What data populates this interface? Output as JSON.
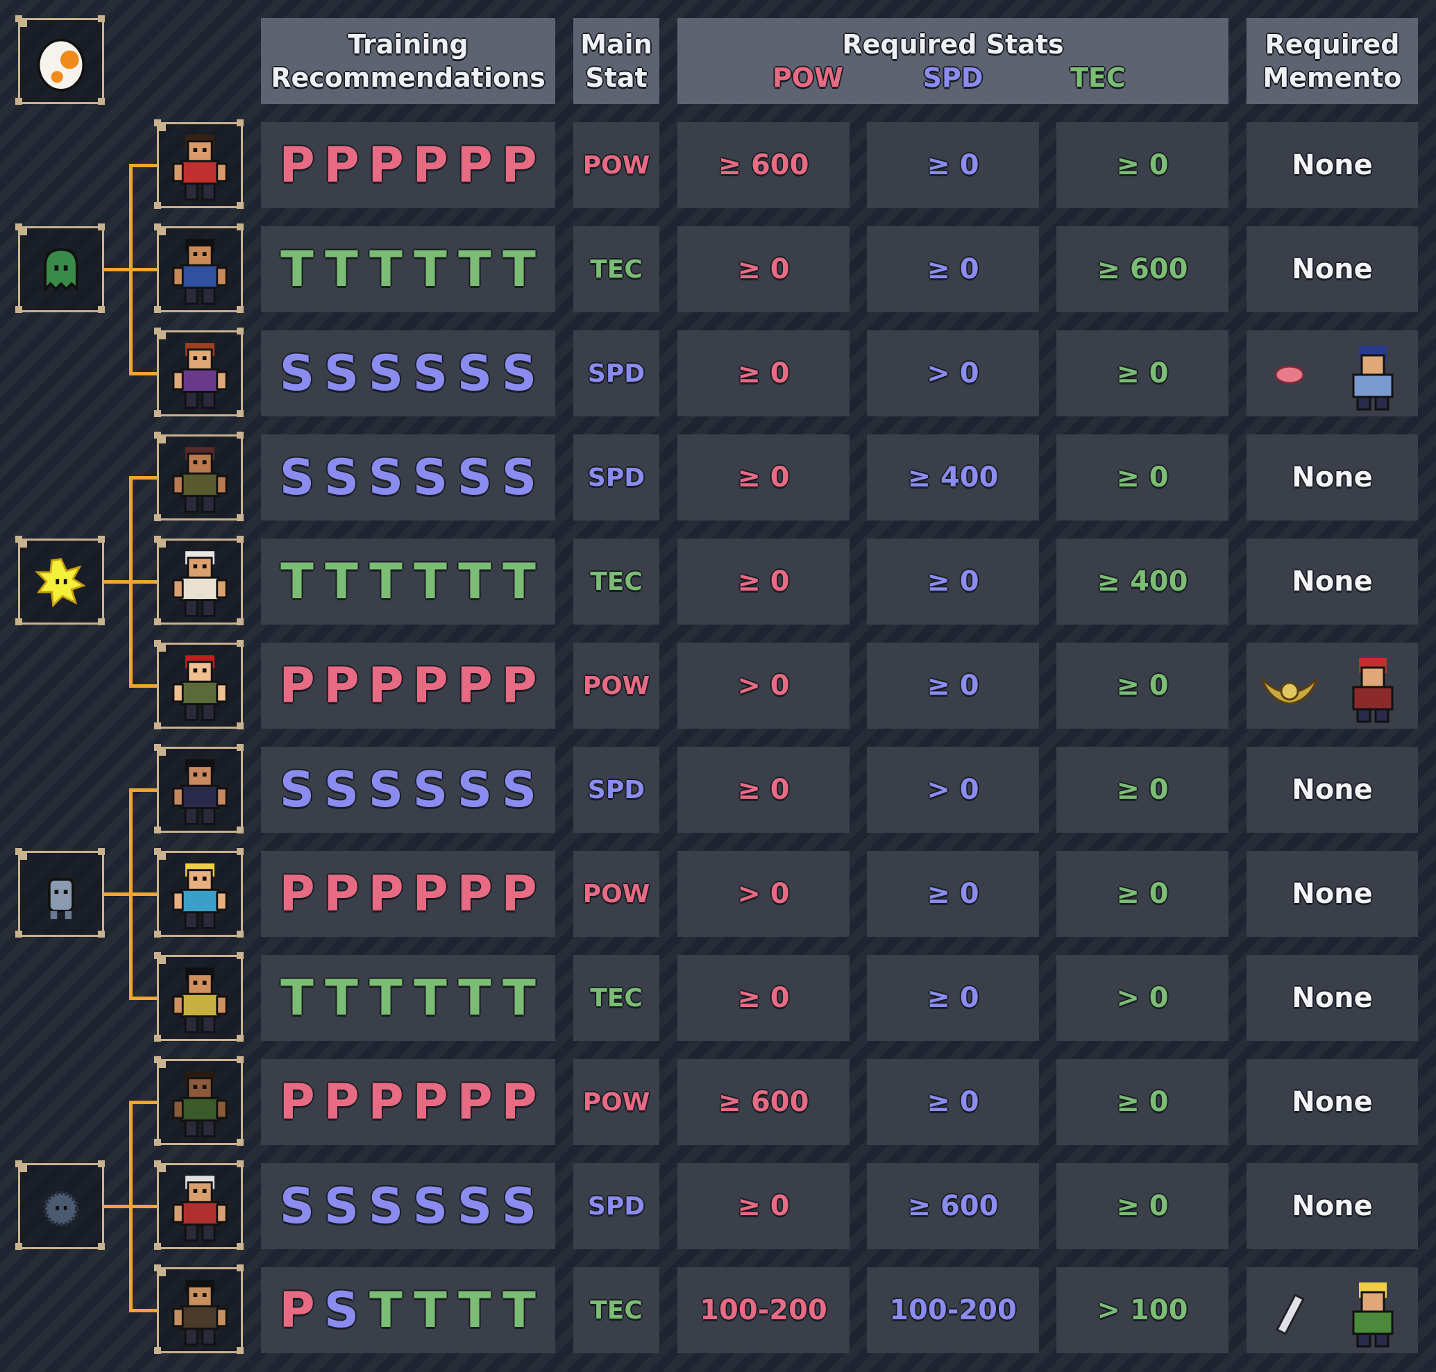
{
  "header": {
    "training": [
      "Training",
      "Recommendations"
    ],
    "main_stat": [
      "Main",
      "Stat"
    ],
    "required_stats": "Required Stats",
    "pow": "POW",
    "spd": "SPD",
    "tec": "TEC",
    "required_memento": [
      "Required",
      "Memento"
    ]
  },
  "groups": [
    {
      "base_icon": "egg-icon"
    },
    {
      "base_icon": "green-ghost-icon"
    },
    {
      "base_icon": "yellow-spark-icon"
    },
    {
      "base_icon": "grey-blob-icon"
    },
    {
      "base_icon": "dark-fuzzball-icon"
    }
  ],
  "rows": [
    {
      "fighter_icon": "fighter-1-icon",
      "training": [
        "P",
        "P",
        "P",
        "P",
        "P",
        "P"
      ],
      "main": "POW",
      "pow": "≥ 600",
      "spd": "≥ 0",
      "tec": "≥ 0",
      "memento": "None"
    },
    {
      "fighter_icon": "fighter-2-icon",
      "training": [
        "T",
        "T",
        "T",
        "T",
        "T",
        "T"
      ],
      "main": "TEC",
      "pow": "≥ 0",
      "spd": "≥ 0",
      "tec": "≥ 600",
      "memento": "None"
    },
    {
      "fighter_icon": "fighter-3-icon",
      "training": [
        "S",
        "S",
        "S",
        "S",
        "S",
        "S"
      ],
      "main": "SPD",
      "pow": "≥ 0",
      "spd": "> 0",
      "tec": "≥ 0",
      "memento": "",
      "memento_icons": [
        "brain-icon",
        "police-officer-icon"
      ]
    },
    {
      "fighter_icon": "fighter-4-icon",
      "training": [
        "S",
        "S",
        "S",
        "S",
        "S",
        "S"
      ],
      "main": "SPD",
      "pow": "≥ 0",
      "spd": "≥ 400",
      "tec": "≥ 0",
      "memento": "None"
    },
    {
      "fighter_icon": "fighter-5-icon",
      "training": [
        "T",
        "T",
        "T",
        "T",
        "T",
        "T"
      ],
      "main": "TEC",
      "pow": "≥ 0",
      "spd": "≥ 0",
      "tec": "≥ 400",
      "memento": "None"
    },
    {
      "fighter_icon": "fighter-6-icon",
      "training": [
        "P",
        "P",
        "P",
        "P",
        "P",
        "P"
      ],
      "main": "POW",
      "pow": "> 0",
      "spd": "≥ 0",
      "tec": "≥ 0",
      "memento": "",
      "memento_icons": [
        "winged-skull-icon",
        "caped-dictator-icon"
      ]
    },
    {
      "fighter_icon": "fighter-7-icon",
      "training": [
        "S",
        "S",
        "S",
        "S",
        "S",
        "S"
      ],
      "main": "SPD",
      "pow": "≥ 0",
      "spd": "> 0",
      "tec": "≥ 0",
      "memento": "None"
    },
    {
      "fighter_icon": "fighter-8-icon",
      "training": [
        "P",
        "P",
        "P",
        "P",
        "P",
        "P"
      ],
      "main": "POW",
      "pow": "> 0",
      "spd": "≥ 0",
      "tec": "≥ 0",
      "memento": "None"
    },
    {
      "fighter_icon": "fighter-9-icon",
      "training": [
        "T",
        "T",
        "T",
        "T",
        "T",
        "T"
      ],
      "main": "TEC",
      "pow": "≥ 0",
      "spd": "≥ 0",
      "tec": "> 0",
      "memento": "None"
    },
    {
      "fighter_icon": "fighter-10-icon",
      "training": [
        "P",
        "P",
        "P",
        "P",
        "P",
        "P"
      ],
      "main": "POW",
      "pow": "≥ 600",
      "spd": "≥ 0",
      "tec": "≥ 0",
      "memento": "None"
    },
    {
      "fighter_icon": "fighter-11-icon",
      "training": [
        "S",
        "S",
        "S",
        "S",
        "S",
        "S"
      ],
      "main": "SPD",
      "pow": "≥ 0",
      "spd": "≥ 600",
      "tec": "≥ 0",
      "memento": "None"
    },
    {
      "fighter_icon": "fighter-12-icon",
      "training": [
        "P",
        "S",
        "T",
        "T",
        "T",
        "T"
      ],
      "main": "TEC",
      "pow": "100-200",
      "spd": "100-200",
      "tec": "> 100",
      "memento": "",
      "memento_icons": [
        "comb-icon",
        "soldier-icon"
      ]
    }
  ],
  "colors": {
    "pow": "#e86b84",
    "spd": "#8b8cf0",
    "tec": "#7bbd74",
    "connector": "#f2a531",
    "frame": "#c9b28f",
    "cell": "#3a3f4a",
    "header": "#5d6370"
  }
}
